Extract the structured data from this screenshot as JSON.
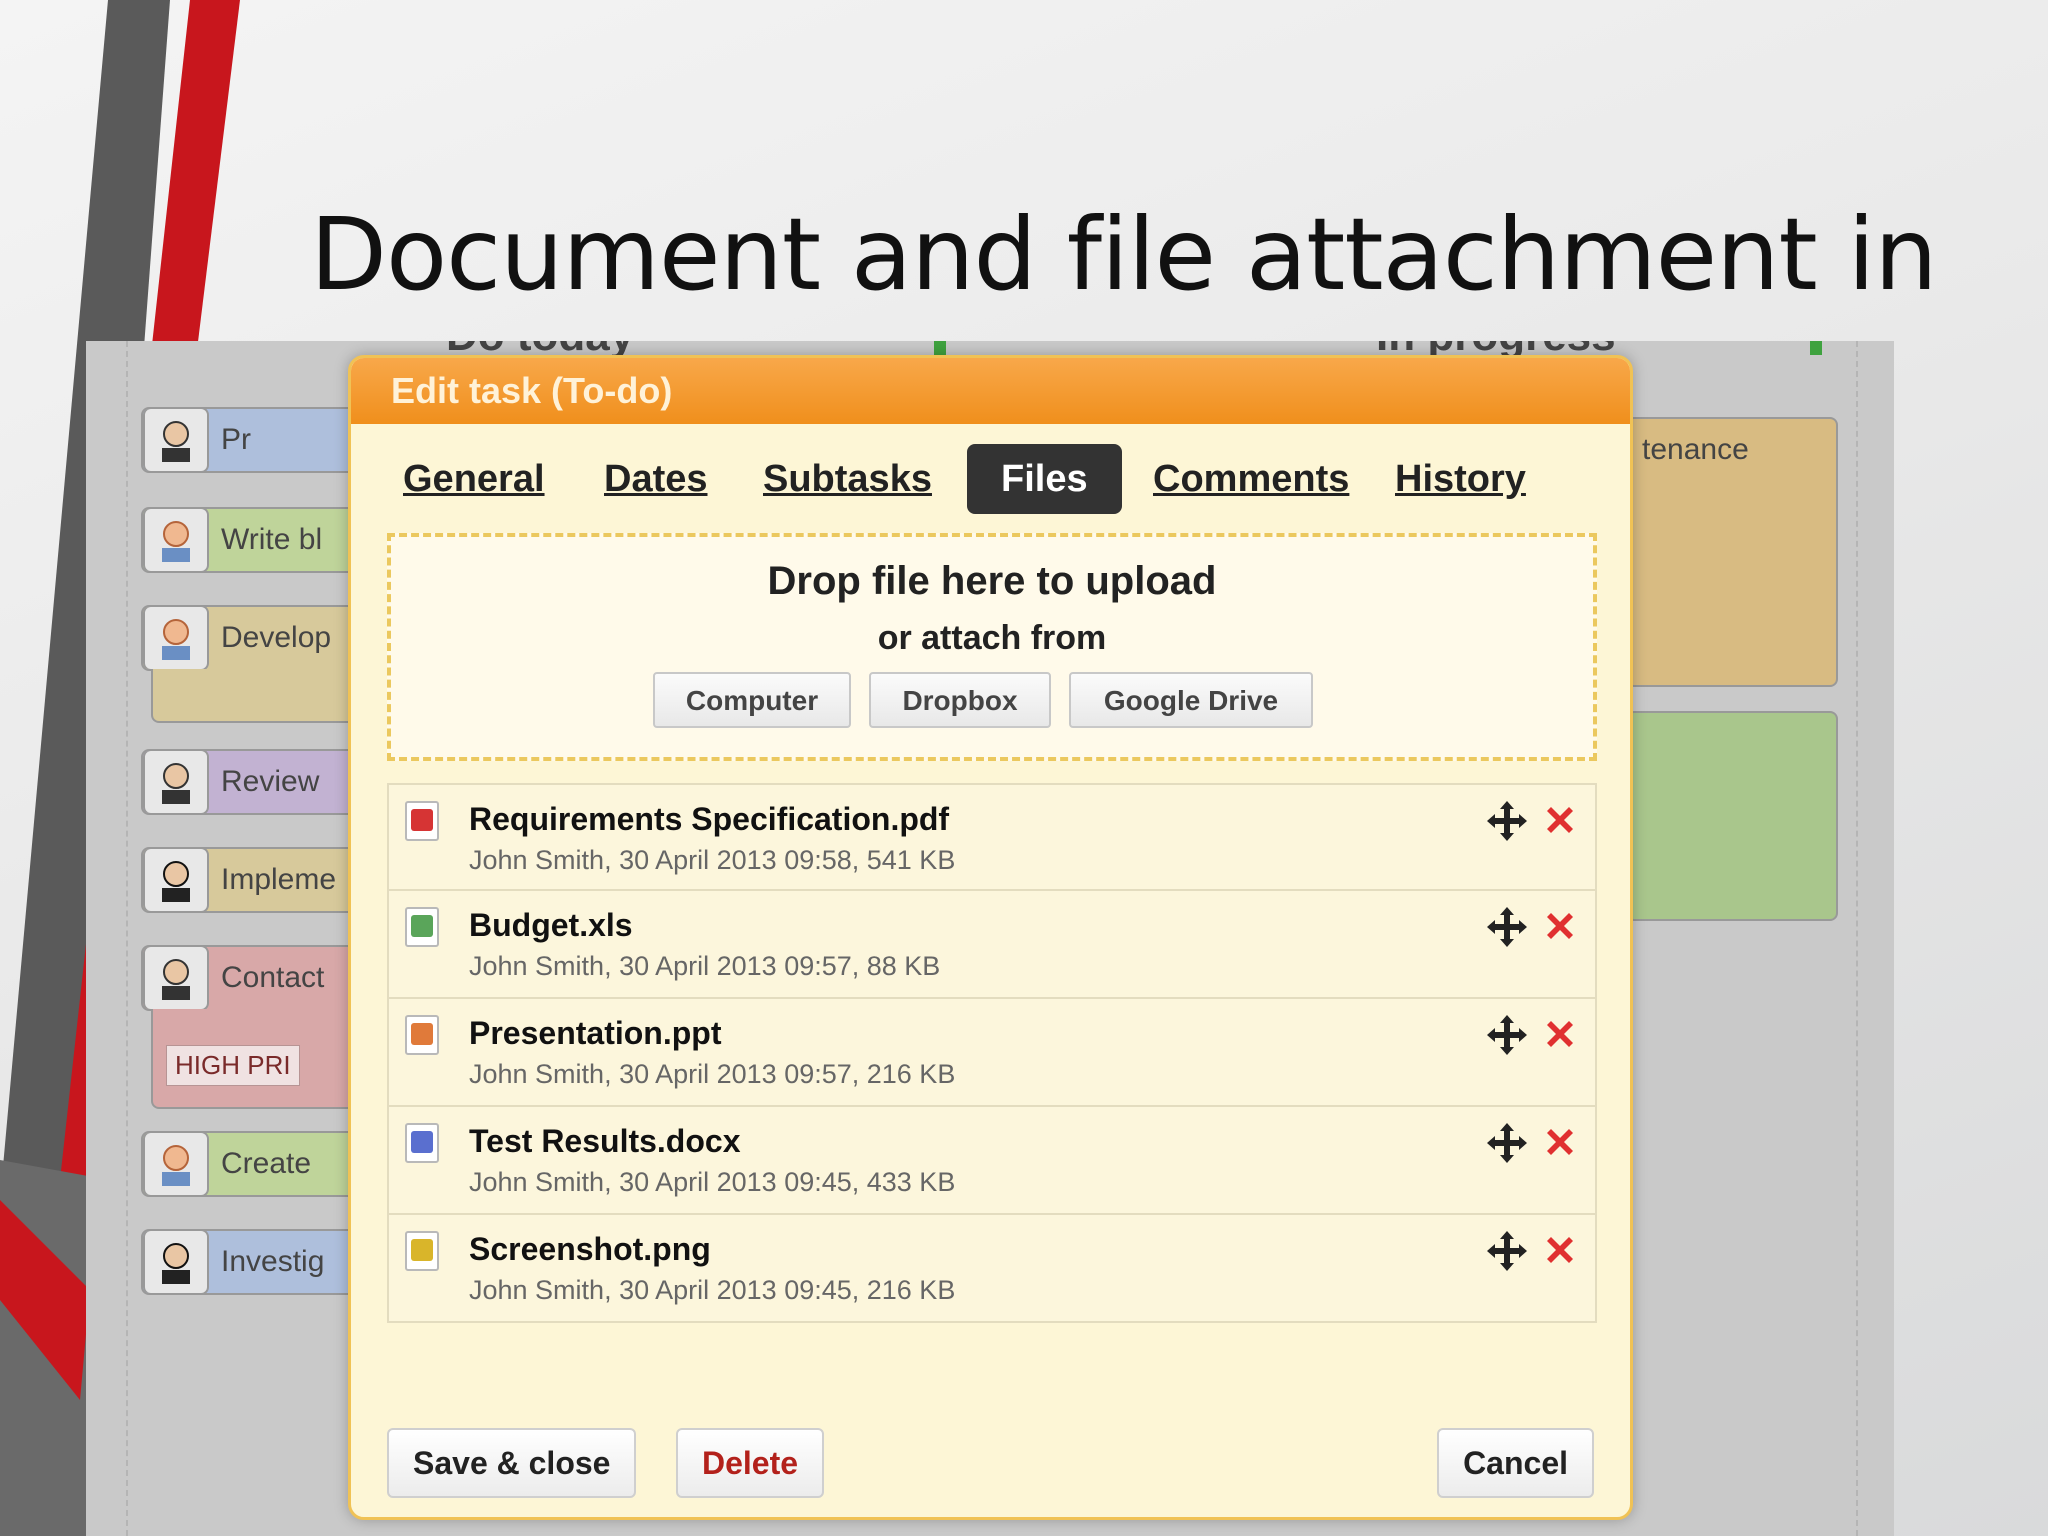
{
  "slide": {
    "title": "Document and file attachment in"
  },
  "board": {
    "columns": [
      "Do today",
      "In progress"
    ],
    "cards": [
      {
        "label": "Pr",
        "color": "blue"
      },
      {
        "label": "Write bl",
        "color": "green"
      },
      {
        "label": "Develop",
        "color": "tan"
      },
      {
        "label": "Review",
        "color": "purple"
      },
      {
        "label": "Impleme",
        "color": "tan"
      },
      {
        "label": "Contact",
        "color": "pink"
      },
      {
        "label": "Create",
        "color": "green"
      },
      {
        "label": "Investig",
        "color": "blue"
      }
    ],
    "high_priority_tag": "HIGH PRI",
    "right_card_label": "tenance"
  },
  "dialog": {
    "title": "Edit task (To-do)",
    "tabs": [
      {
        "label": "General",
        "active": false
      },
      {
        "label": "Dates",
        "active": false
      },
      {
        "label": "Subtasks",
        "active": false
      },
      {
        "label": "Files",
        "active": true
      },
      {
        "label": "Comments",
        "active": false
      },
      {
        "label": "History",
        "active": false
      }
    ],
    "dropzone": {
      "title": "Drop file here to upload",
      "subtitle": "or attach from",
      "sources": [
        "Computer",
        "Dropbox",
        "Google Drive"
      ]
    },
    "files": [
      {
        "name": "Requirements Specification.pdf",
        "meta": "John Smith, 30 April 2013 09:58, 541 KB",
        "icon": "pdf-icon",
        "color": "#d63434"
      },
      {
        "name": "Budget.xls",
        "meta": "John Smith, 30 April 2013 09:57, 88 KB",
        "icon": "spreadsheet-icon",
        "color": "#5aa55a"
      },
      {
        "name": "Presentation.ppt",
        "meta": "John Smith, 30 April 2013 09:57, 216 KB",
        "icon": "presentation-icon",
        "color": "#e07a3a"
      },
      {
        "name": "Test Results.docx",
        "meta": "John Smith, 30 April 2013 09:45, 433 KB",
        "icon": "document-icon",
        "color": "#5a6fcf"
      },
      {
        "name": "Screenshot.png",
        "meta": "John Smith, 30 April 2013 09:45, 216 KB",
        "icon": "image-icon",
        "color": "#d9b52a"
      }
    ],
    "buttons": {
      "save": "Save & close",
      "delete": "Delete",
      "cancel": "Cancel"
    },
    "colors": {
      "header": "#f08f1c",
      "body": "#fdf6d6",
      "delete_icon": "#e03030"
    }
  }
}
